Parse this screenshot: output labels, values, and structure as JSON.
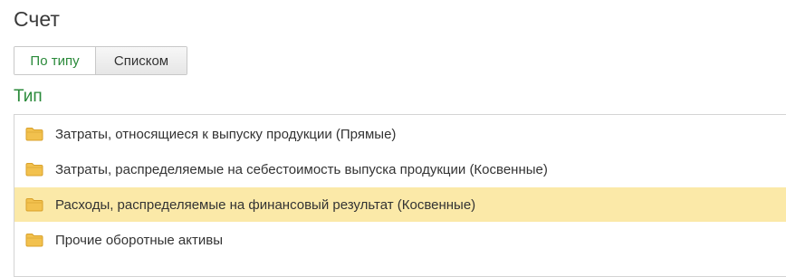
{
  "page": {
    "title": "Счет"
  },
  "view_toggle": {
    "by_type_label": "По типу",
    "list_label": "Списком",
    "active": "by_type"
  },
  "type_section": {
    "label": "Тип"
  },
  "type_list": {
    "items": [
      {
        "label": "Затраты, относящиеся к выпуску продукции (Прямые)",
        "icon": "folder-icon",
        "selected": false
      },
      {
        "label": "Затраты, распределяемые на себестоимость выпуска продукции (Косвенные)",
        "icon": "folder-icon",
        "selected": false
      },
      {
        "label": "Расходы, распределяемые на финансовый результат (Косвенные)",
        "icon": "folder-icon",
        "selected": true
      },
      {
        "label": "Прочие оборотные активы",
        "icon": "folder-icon",
        "selected": false
      }
    ]
  },
  "colors": {
    "accent_green": "#2a8a3a",
    "selection": "#fbe9a8",
    "folder": "#f2c14e"
  }
}
